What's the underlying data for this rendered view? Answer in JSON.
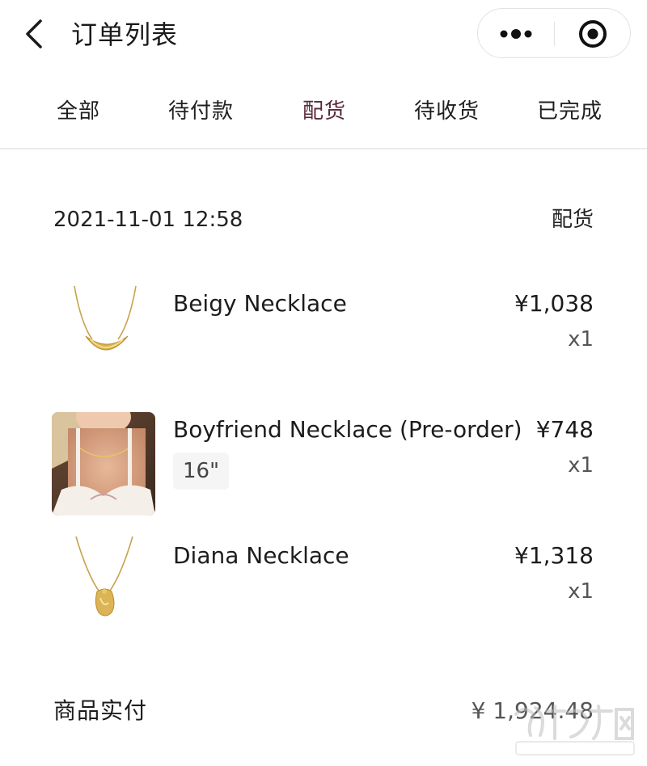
{
  "header": {
    "title": "订单列表",
    "back_icon": "chevron-left-icon",
    "more_icon": "more-dots-icon",
    "target_icon": "record-target-icon"
  },
  "tabs": [
    {
      "label": "全部",
      "active": false
    },
    {
      "label": "待付款",
      "active": false
    },
    {
      "label": "配货",
      "active": true
    },
    {
      "label": "待收货",
      "active": false
    },
    {
      "label": "已完成",
      "active": false
    }
  ],
  "order": {
    "datetime": "2021-11-01 12:58",
    "status": "配货",
    "items": [
      {
        "name": "Beigy Necklace",
        "price": "¥1,038",
        "qty": "x1",
        "variant": ""
      },
      {
        "name": "Boyfriend Necklace (Pre-order)",
        "price": "¥748",
        "qty": "x1",
        "variant": "16\""
      },
      {
        "name": "Diana Necklace",
        "price": "¥1,318",
        "qty": "x1",
        "variant": ""
      }
    ]
  },
  "summary": {
    "label": "商品实付",
    "value": "¥ 1,924.48"
  },
  "colors": {
    "active_tab": "#5a2a3a",
    "gold": "#d4a93a"
  }
}
